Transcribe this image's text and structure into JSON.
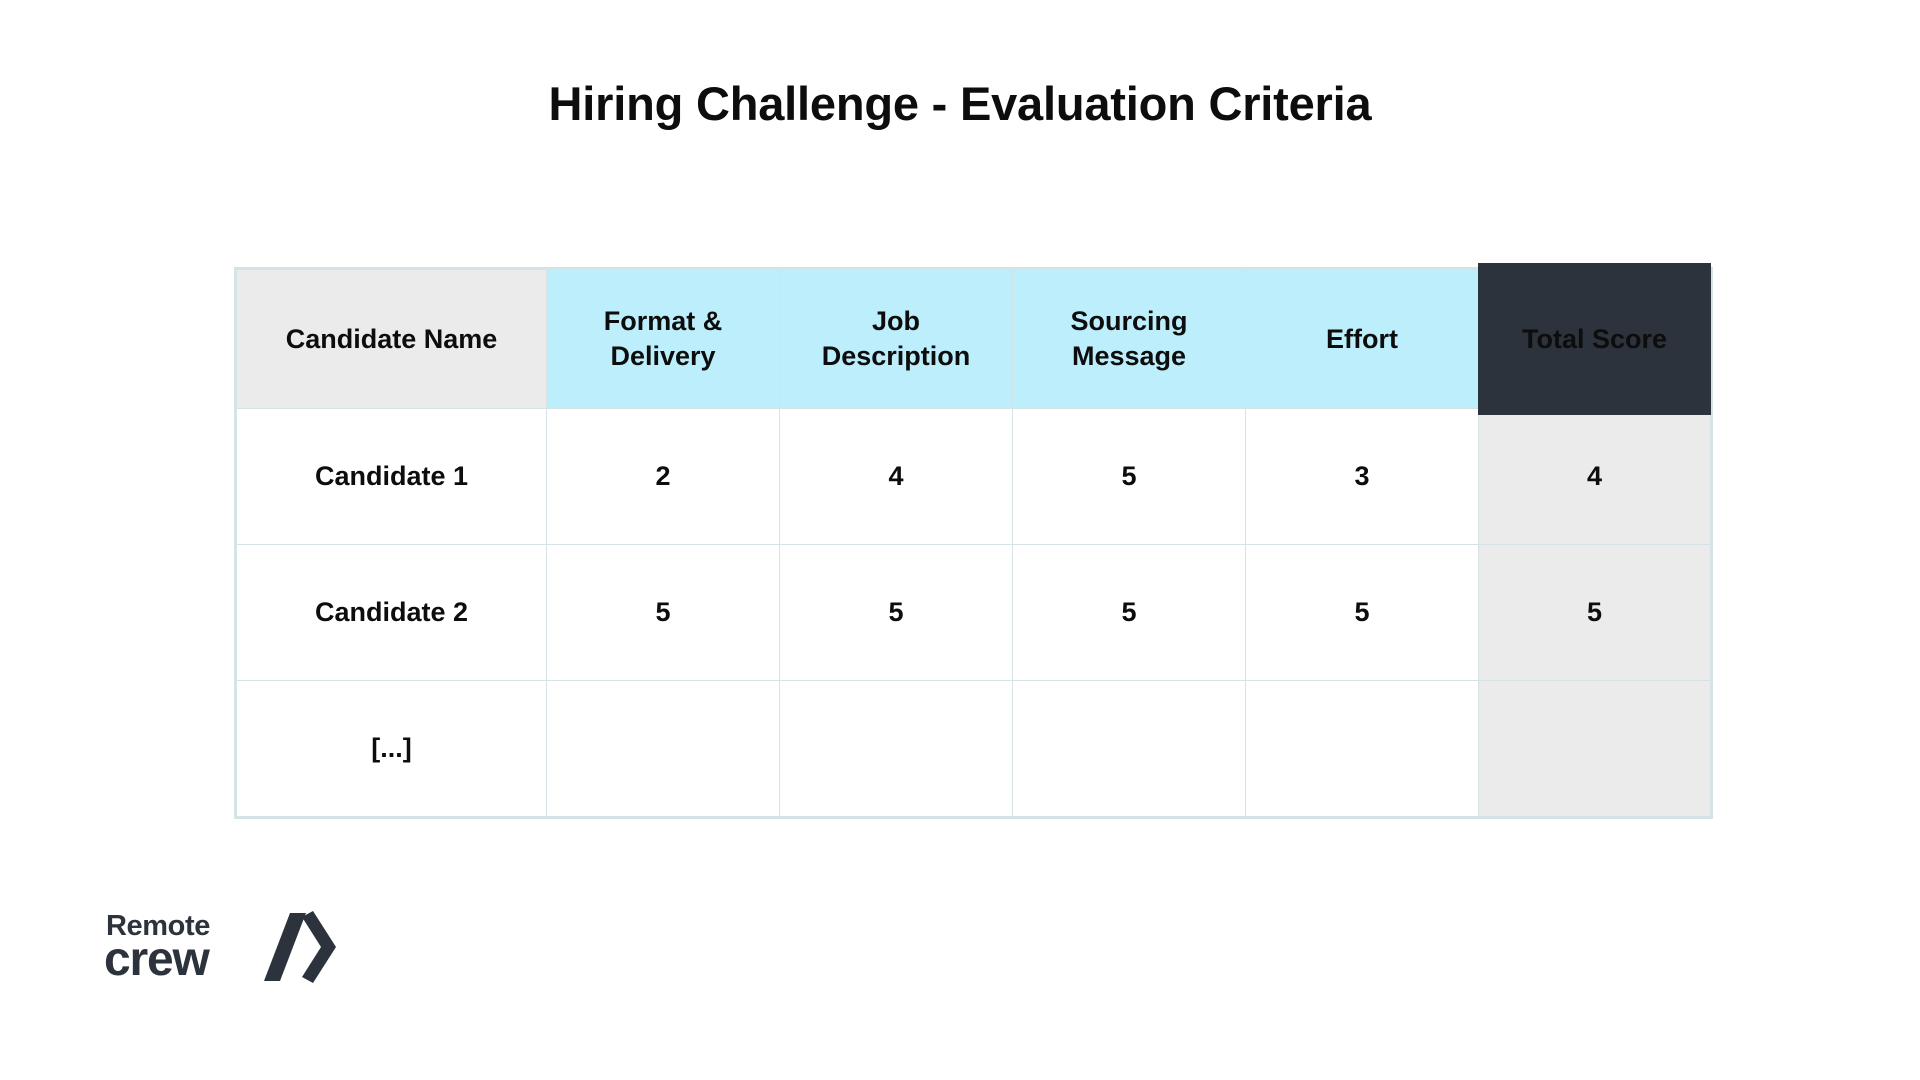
{
  "slide": {
    "title": "Hiring Challenge - Evaluation Criteria",
    "background_color": "#ffffff"
  },
  "table": {
    "colors": {
      "name_header_bg": "#ebebeb",
      "criteria_header_bg": "#bdeefb",
      "total_header_bg": "#2c333c",
      "total_header_text": "#ffffff",
      "total_column_bg": "#ebebeb",
      "border": "#d5e2e6",
      "text": "#0d0d0d"
    },
    "headers": [
      {
        "label": "Candidate Name",
        "line1": "Candidate Name",
        "line2": "",
        "style": "name"
      },
      {
        "label": "Format & Delivery",
        "line1": "Format &",
        "line2": "Delivery",
        "style": "criteria"
      },
      {
        "label": "Job Description",
        "line1": "Job",
        "line2": "Description",
        "style": "criteria"
      },
      {
        "label": "Sourcing Message",
        "line1": "Sourcing",
        "line2": "Message",
        "style": "criteria"
      },
      {
        "label": "Effort",
        "line1": "Effort",
        "line2": "",
        "style": "criteria"
      },
      {
        "label": "Total Score",
        "line1": "Total Score",
        "line2": "",
        "style": "total"
      }
    ],
    "rows": [
      {
        "name": "Candidate 1",
        "format_delivery": "2",
        "job_description": "4",
        "sourcing_message": "5",
        "effort": "3",
        "total_score": "4"
      },
      {
        "name": "Candidate 2",
        "format_delivery": "5",
        "job_description": "5",
        "sourcing_message": "5",
        "effort": "5",
        "total_score": "5"
      },
      {
        "name": "[...]",
        "format_delivery": "",
        "job_description": "",
        "sourcing_message": "",
        "effort": "",
        "total_score": ""
      }
    ]
  },
  "logo": {
    "line1": "Remote",
    "line2": "crew",
    "mark": "slash-chevron",
    "color": "#2c333c"
  }
}
